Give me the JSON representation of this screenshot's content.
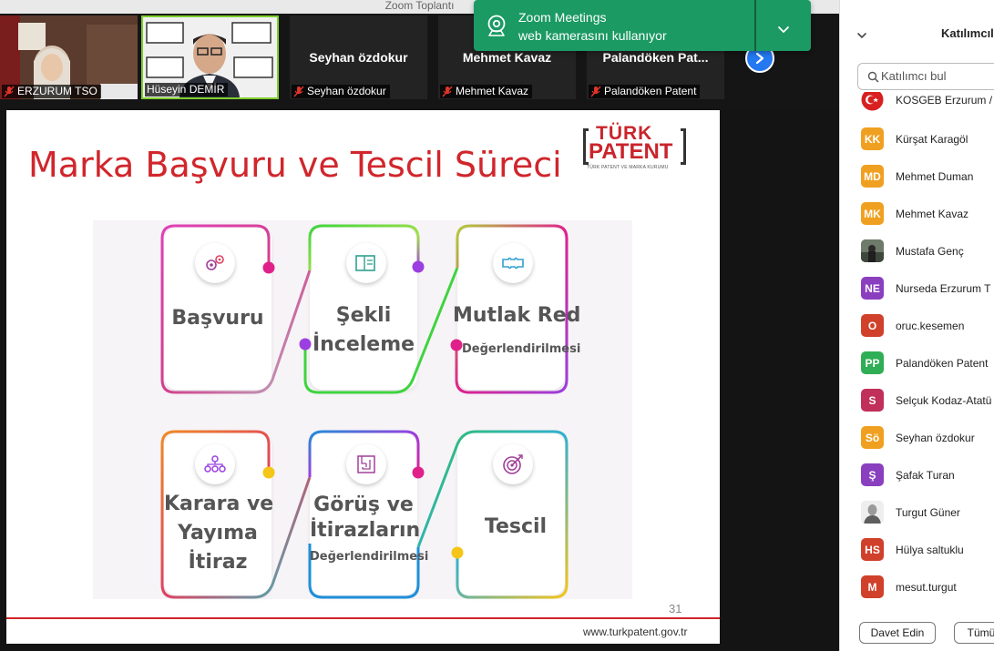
{
  "window": {
    "title": "Zoom Toplantı"
  },
  "toast": {
    "line1": "Zoom Meetings",
    "line2": "web kamerasını kullanıyor"
  },
  "video_tiles": [
    {
      "label": "ERZURUM TSO",
      "type": "camera"
    },
    {
      "label": "Hüseyin DEMİR",
      "type": "camera-speaker"
    },
    {
      "big_name": "Seyhan özdokur",
      "label": "Seyhan özdokur",
      "type": "name-only"
    },
    {
      "big_name": "Mehmet Kavaz",
      "label": "Mehmet Kavaz",
      "type": "name-only"
    },
    {
      "big_name": "Palandöken  Pat...",
      "label": "Palandöken Patent",
      "type": "name-only"
    }
  ],
  "slide": {
    "title": "Marka Başvuru ve Tescil Süreci",
    "logo": {
      "line1": "TÜRK",
      "line2": "PATENT",
      "sub": "TÜRK PATENT VE MARKA KURUMU"
    },
    "steps": [
      {
        "label": "Başvuru",
        "sub": ""
      },
      {
        "label_line1": "Şekli",
        "label_line2": "İnceleme",
        "sub": ""
      },
      {
        "label": "Mutlak Red",
        "sub": "Değerlendirilmesi"
      },
      {
        "label_line1": "Karara ve",
        "label_line2": "Yayıma",
        "label_line3": "İtiraz",
        "sub": ""
      },
      {
        "label_line1": "Görüş ve",
        "label_line2": "İtirazların",
        "sub": "Değerlendirilmesi"
      },
      {
        "label": "Tescil",
        "sub": ""
      }
    ],
    "page_number": "31",
    "footer_url": "www.turkpatent.gov.tr",
    "colors": {
      "title_red": "#d0262c",
      "magenta": "#e0218a",
      "green": "#3fcf3f",
      "purple": "#9b3fe0",
      "orange": "#f08a24",
      "blue": "#1f8fd8",
      "yellow": "#f5c518"
    }
  },
  "panel": {
    "title": "Katılımcıla",
    "search_placeholder": "Katılımcı bul",
    "participants": [
      {
        "initials": "",
        "name": "KOSGEB Erzurum /",
        "color": "#d92020",
        "avatar": "flag"
      },
      {
        "initials": "KK",
        "name": "Kürşat Karagöl",
        "color": "#f0a020"
      },
      {
        "initials": "MD",
        "name": "Mehmet Duman",
        "color": "#f0a020"
      },
      {
        "initials": "MK",
        "name": "Mehmet Kavaz",
        "color": "#f0a020"
      },
      {
        "initials": "",
        "name": "Mustafa Genç",
        "color": "#556055",
        "avatar": "photo"
      },
      {
        "initials": "NE",
        "name": "Nurseda Erzurum T",
        "color": "#8a3fbf"
      },
      {
        "initials": "O",
        "name": "oruc.kesemen",
        "color": "#d0402a"
      },
      {
        "initials": "PP",
        "name": "Palandöken Patent",
        "color": "#2fae55"
      },
      {
        "initials": "S",
        "name": "Selçuk Kodaz-Atatü",
        "color": "#c0305a"
      },
      {
        "initials": "Sö",
        "name": "Seyhan özdokur",
        "color": "#f0a020"
      },
      {
        "initials": "Ş",
        "name": "Şafak Turan",
        "color": "#8a3fbf"
      },
      {
        "initials": "",
        "name": "Turgut Güner",
        "color": "#e8e8e8",
        "avatar": "person-photo"
      },
      {
        "initials": "HS",
        "name": "Hülya saltuklu",
        "color": "#d0402a"
      },
      {
        "initials": "M",
        "name": "mesut.turgut",
        "color": "#d0402a"
      }
    ],
    "invite_button": "Davet Edin",
    "mute_all_button": "Tümü"
  }
}
